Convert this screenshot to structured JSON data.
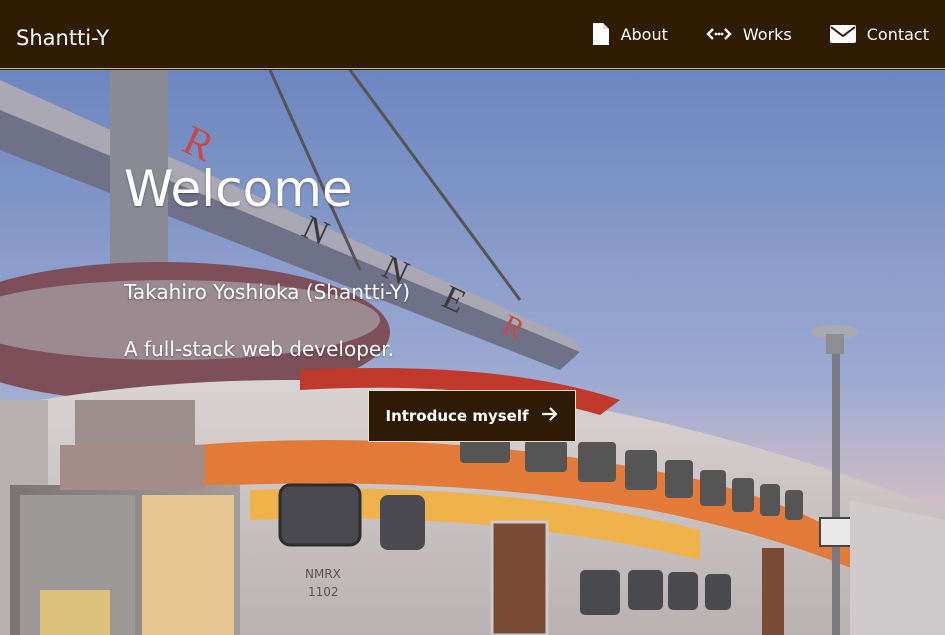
{
  "header": {
    "brand": "Shantti-Y",
    "nav": [
      {
        "label": "About",
        "icon": "document-icon"
      },
      {
        "label": "Works",
        "icon": "code-icon"
      },
      {
        "label": "Contact",
        "icon": "mail-icon"
      }
    ]
  },
  "hero": {
    "title": "Welcome",
    "name": "Takahiro Yoshioka (Shantti-Y)",
    "tagline": "A full-stack web developer.",
    "cta_label": "Introduce myself",
    "cta_icon": "arrow-right-icon",
    "photo_signage": "RUNNER",
    "train_number": "NMRX 1102"
  },
  "colors": {
    "header_bg": "#301b04",
    "button_bg": "#2f1a05",
    "sky_top": "#6d86bf",
    "sky_bottom": "#e7c6b6"
  }
}
